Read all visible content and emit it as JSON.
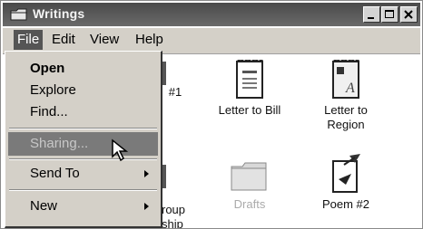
{
  "window": {
    "title": "Writings",
    "buttons": {
      "minimize": "minimize-icon",
      "maximize": "maximize-icon",
      "close": "close-icon"
    }
  },
  "menubar": {
    "items": [
      "File",
      "Edit",
      "View",
      "Help"
    ]
  },
  "file_menu": {
    "items": [
      {
        "label": "Open"
      },
      {
        "label": "Explore"
      },
      {
        "label": "Find..."
      },
      {
        "label": "Sharing..."
      },
      {
        "label": "Send To"
      },
      {
        "label": "New"
      }
    ]
  },
  "icons": [
    {
      "label": "#1"
    },
    {
      "label": "Letter to Bill"
    },
    {
      "label": "Letter to\nRegion"
    },
    {
      "label": "roup\nship"
    },
    {
      "label": "Drafts"
    },
    {
      "label": "Poem #2"
    }
  ],
  "colors": {
    "titlebar": "#4a4a4a",
    "menu_bg": "#d4d0c8",
    "highlight": "#7a7a7a"
  }
}
